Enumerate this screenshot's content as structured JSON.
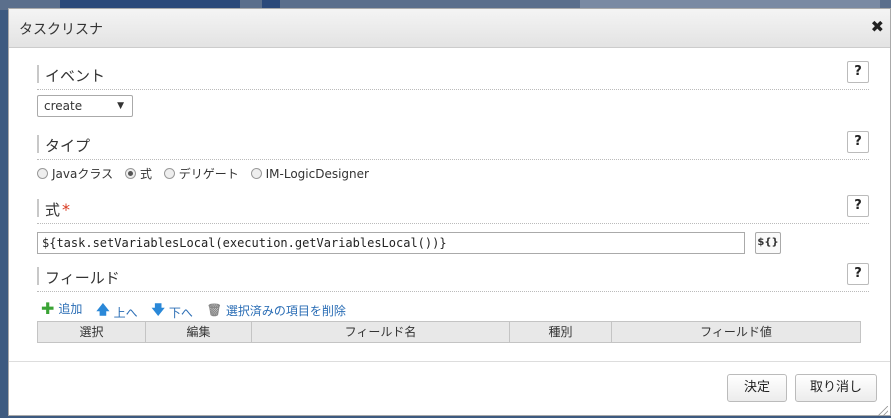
{
  "dialog": {
    "title": "タスクリスナ",
    "close_symbol": "✖"
  },
  "event": {
    "label": "イベント",
    "selected": "create",
    "help": "?"
  },
  "type": {
    "label": "タイプ",
    "help": "?",
    "options": [
      {
        "label": "Javaクラス",
        "checked": false
      },
      {
        "label": "式",
        "checked": true
      },
      {
        "label": "デリゲート",
        "checked": false
      },
      {
        "label": "IM-LogicDesigner",
        "checked": false
      }
    ]
  },
  "expression": {
    "label": "式",
    "required_mark": "*",
    "help": "?",
    "value": "${task.setVariablesLocal(execution.getVariablesLocal())}",
    "button_label": "${}"
  },
  "fields": {
    "label": "フィールド",
    "help": "?",
    "toolbar": {
      "add": "追加",
      "up": "上へ",
      "down": "下へ",
      "delete_selected": "選択済みの項目を削除"
    },
    "columns": [
      "選択",
      "編集",
      "フィールド名",
      "種別",
      "フィールド値"
    ]
  },
  "footer": {
    "ok": "決定",
    "cancel": "取り消し"
  },
  "colors": {
    "accent_link": "#2a6db5",
    "add_icon": "#3aa335",
    "arrow_icon": "#2a88d8",
    "required": "#d9381e"
  }
}
